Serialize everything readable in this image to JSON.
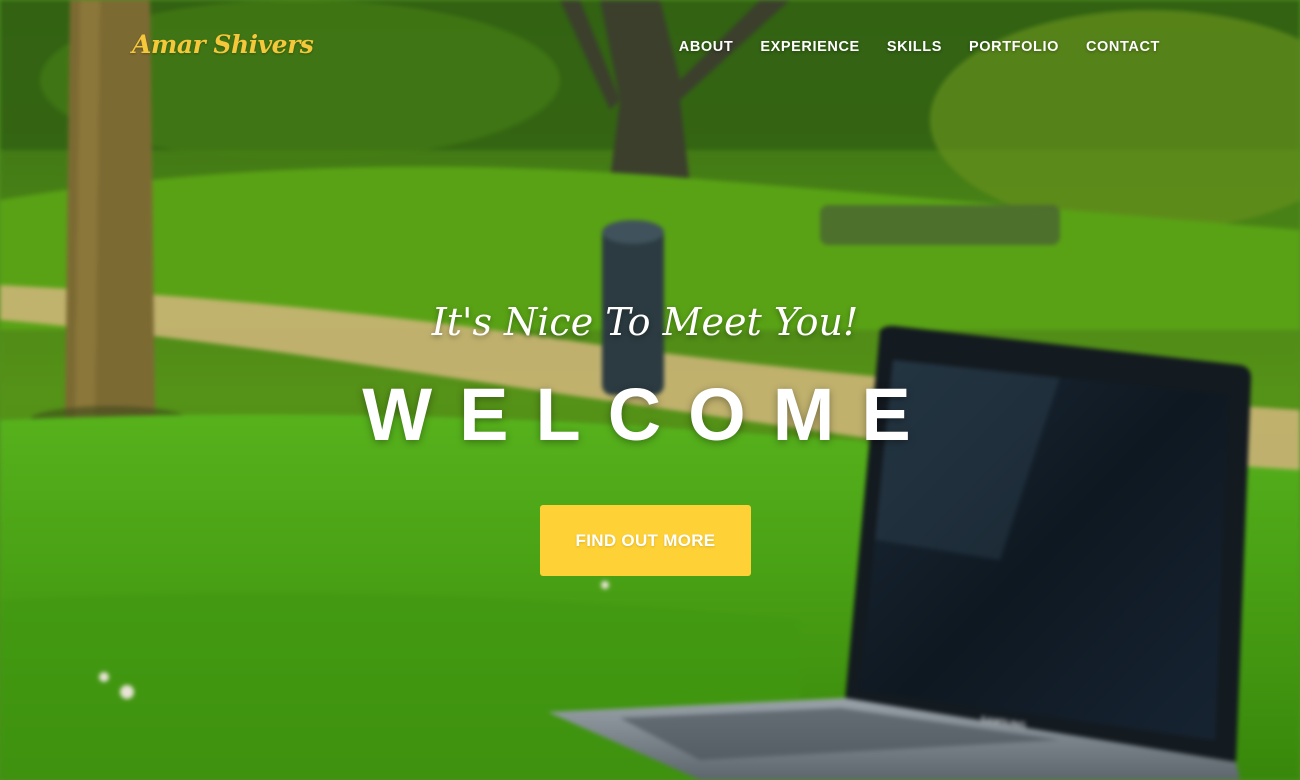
{
  "navbar": {
    "brand": "Amar Shivers",
    "links": [
      {
        "label": "ABOUT"
      },
      {
        "label": "EXPERIENCE"
      },
      {
        "label": "SKILLS"
      },
      {
        "label": "PORTFOLIO"
      },
      {
        "label": "CONTACT"
      }
    ]
  },
  "hero": {
    "subheading": "It's Nice To Meet You!",
    "heading": "WELCOME",
    "button_label": "FIND OUT MORE",
    "laptop_brand": "SAMSUNG"
  },
  "colors": {
    "brand": "#f5c73a",
    "accent": "#fed136",
    "text": "#ffffff"
  },
  "icons": {
    "background": "park-lawn-with-laptop-photo"
  }
}
